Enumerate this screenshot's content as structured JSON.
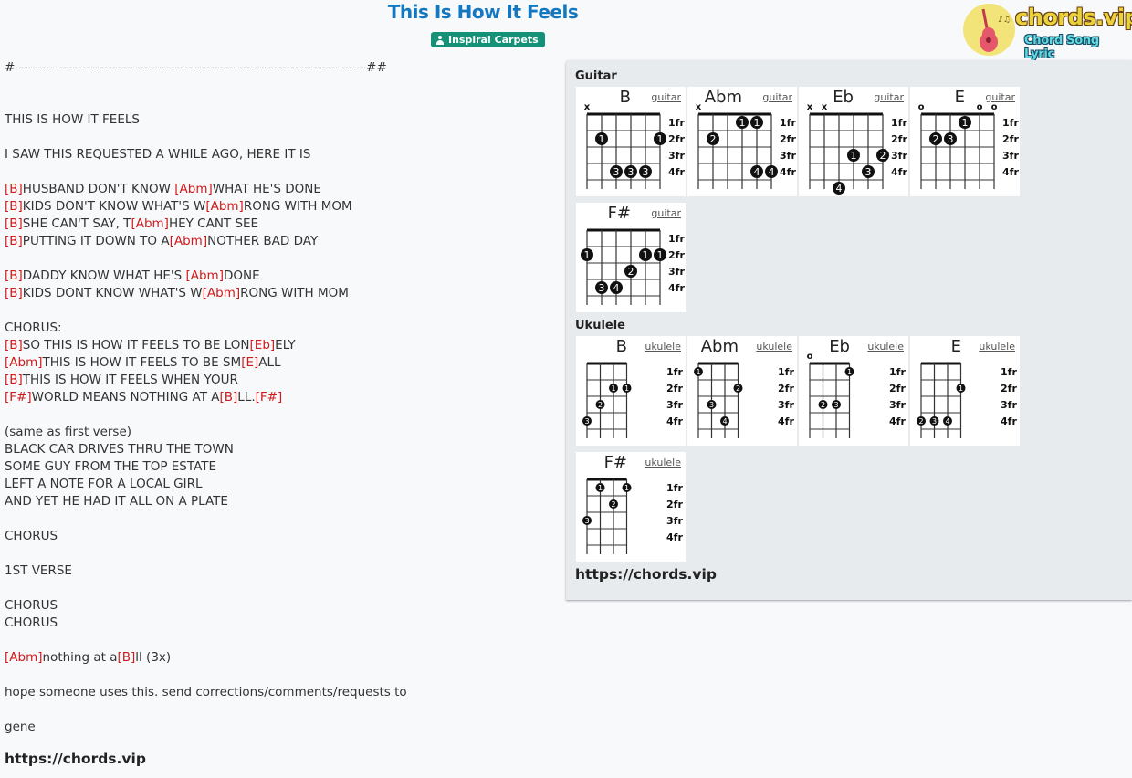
{
  "header": {
    "title": "This Is How It Feels",
    "artist": "Inspiral Carpets",
    "artist_icon": "user-icon",
    "logo_text": "chords.vip",
    "logo_subtitle": "Chord Song Lyric"
  },
  "colors": {
    "title": "#1478c0",
    "badge": "#159177",
    "chord": "#d11a1a",
    "panel": "#e8ebee"
  },
  "lyrics": [
    [
      {
        "t": "#-------------------------------------------------------------------------------##"
      }
    ],
    [],
    [],
    [
      {
        "t": "THIS IS HOW IT FEELS"
      }
    ],
    [],
    [
      {
        "t": "I SAW THIS REQUESTED A WHILE AGO, HERE IT IS"
      }
    ],
    [],
    [
      {
        "c": "[B]"
      },
      {
        "t": "HUSBAND DON'T KNOW "
      },
      {
        "c": "[Abm]"
      },
      {
        "t": "WHAT HE'S DONE"
      }
    ],
    [
      {
        "c": "[B]"
      },
      {
        "t": "KIDS DON'T KNOW WHAT'S W"
      },
      {
        "c": "[Abm]"
      },
      {
        "t": "RONG WITH MOM"
      }
    ],
    [
      {
        "c": "[B]"
      },
      {
        "t": "SHE CAN'T SAY, T"
      },
      {
        "c": "[Abm]"
      },
      {
        "t": "HEY CANT SEE"
      }
    ],
    [
      {
        "c": "[B]"
      },
      {
        "t": "PUTTING IT DOWN TO A"
      },
      {
        "c": "[Abm]"
      },
      {
        "t": "NOTHER BAD DAY"
      }
    ],
    [],
    [
      {
        "c": "[B]"
      },
      {
        "t": "DADDY KNOW WHAT HE'S "
      },
      {
        "c": "[Abm]"
      },
      {
        "t": "DONE"
      }
    ],
    [
      {
        "c": "[B]"
      },
      {
        "t": "KIDS DONT KNOW WHAT'S W"
      },
      {
        "c": "[Abm]"
      },
      {
        "t": "RONG WITH MOM"
      }
    ],
    [],
    [
      {
        "t": "CHORUS:"
      }
    ],
    [
      {
        "c": "[B]"
      },
      {
        "t": "SO THIS IS HOW IT FEELS TO BE LON"
      },
      {
        "c": "[Eb]"
      },
      {
        "t": "ELY"
      }
    ],
    [
      {
        "c": "[Abm]"
      },
      {
        "t": "THIS IS HOW IT FEELS TO BE SM"
      },
      {
        "c": "[E]"
      },
      {
        "t": "ALL"
      }
    ],
    [
      {
        "c": "[B]"
      },
      {
        "t": "THIS IS HOW IT FEELS WHEN YOUR"
      }
    ],
    [
      {
        "c": "[F#]"
      },
      {
        "t": "WORLD MEANS NOTHING AT A"
      },
      {
        "c": "[B]"
      },
      {
        "t": "LL."
      },
      {
        "c": "[F#]"
      }
    ],
    [],
    [
      {
        "t": "(same as first verse)"
      }
    ],
    [
      {
        "t": "BLACK CAR DRIVES THRU THE TOWN"
      }
    ],
    [
      {
        "t": "SOME GUY FROM THE TOP ESTATE"
      }
    ],
    [
      {
        "t": "LEFT A NOTE FOR A LOCAL GIRL"
      }
    ],
    [
      {
        "t": "AND YET HE HAD IT ALL ON A PLATE"
      }
    ],
    [],
    [
      {
        "t": "CHORUS"
      }
    ],
    [],
    [
      {
        "t": "1ST VERSE"
      }
    ],
    [],
    [
      {
        "t": "CHORUS"
      }
    ],
    [
      {
        "t": "CHORUS"
      }
    ],
    [],
    [
      {
        "c": "[Abm]"
      },
      {
        "t": "nothing at a"
      },
      {
        "c": "[B]"
      },
      {
        "t": "ll (3x)"
      }
    ],
    [],
    [
      {
        "t": "hope someone uses this. send corrections/comments/requests to"
      }
    ],
    [],
    [
      {
        "t": "gene"
      }
    ]
  ],
  "footer_link": "https://chords.vip",
  "panel": {
    "guitar_title": "Guitar",
    "ukulele_title": "Ukulele",
    "link": "https://chords.vip",
    "fret_labels": [
      "1fr",
      "2fr",
      "3fr",
      "4fr"
    ],
    "guitar_chords": [
      {
        "name": "B",
        "type": "guitar",
        "markers": [
          "x",
          "",
          "",
          "",
          "",
          ""
        ],
        "dots": [
          {
            "s": 1,
            "f": 2,
            "n": "1"
          },
          {
            "s": 5,
            "f": 2,
            "n": "1"
          },
          {
            "s": 2,
            "f": 4,
            "n": "3"
          },
          {
            "s": 3,
            "f": 4,
            "n": "3"
          },
          {
            "s": 4,
            "f": 4,
            "n": "3"
          }
        ]
      },
      {
        "name": "Abm",
        "type": "guitar",
        "markers": [
          "x",
          "",
          "",
          "",
          "",
          ""
        ],
        "dots": [
          {
            "s": 3,
            "f": 1,
            "n": "1"
          },
          {
            "s": 4,
            "f": 1,
            "n": "1"
          },
          {
            "s": 1,
            "f": 2,
            "n": "2"
          },
          {
            "s": 4,
            "f": 4,
            "n": "4"
          },
          {
            "s": 5,
            "f": 4,
            "n": "4"
          }
        ]
      },
      {
        "name": "Eb",
        "type": "guitar",
        "markers": [
          "x",
          "x",
          "",
          "",
          "",
          ""
        ],
        "dots": [
          {
            "s": 3,
            "f": 3,
            "n": "1"
          },
          {
            "s": 5,
            "f": 3,
            "n": "2"
          },
          {
            "s": 4,
            "f": 4,
            "n": "3"
          },
          {
            "s": 2,
            "f": 5,
            "n": "4"
          }
        ]
      },
      {
        "name": "E",
        "type": "guitar",
        "markers": [
          "o",
          "",
          "",
          "",
          "o",
          "o"
        ],
        "dots": [
          {
            "s": 3,
            "f": 1,
            "n": "1"
          },
          {
            "s": 1,
            "f": 2,
            "n": "2"
          },
          {
            "s": 2,
            "f": 2,
            "n": "3"
          }
        ]
      },
      {
        "name": "F#",
        "type": "guitar",
        "markers": [
          "",
          "",
          "",
          "",
          "",
          ""
        ],
        "dots": [
          {
            "s": 0,
            "f": 2,
            "n": "1"
          },
          {
            "s": 4,
            "f": 2,
            "n": "1"
          },
          {
            "s": 5,
            "f": 2,
            "n": "1"
          },
          {
            "s": 3,
            "f": 3,
            "n": "2"
          },
          {
            "s": 1,
            "f": 4,
            "n": "3"
          },
          {
            "s": 2,
            "f": 4,
            "n": "4"
          }
        ]
      }
    ],
    "ukulele_chords": [
      {
        "name": "B",
        "type": "ukulele",
        "markers": [
          "",
          "",
          "",
          ""
        ],
        "dots": [
          {
            "s": 2,
            "f": 2,
            "n": "1"
          },
          {
            "s": 3,
            "f": 2,
            "n": "1"
          },
          {
            "s": 1,
            "f": 3,
            "n": "2"
          },
          {
            "s": 0,
            "f": 4,
            "n": "3"
          }
        ]
      },
      {
        "name": "Abm",
        "type": "ukulele",
        "markers": [
          "",
          "",
          "",
          ""
        ],
        "dots": [
          {
            "s": 0,
            "f": 1,
            "n": "1"
          },
          {
            "s": 3,
            "f": 2,
            "n": "2"
          },
          {
            "s": 1,
            "f": 3,
            "n": "3"
          },
          {
            "s": 2,
            "f": 4,
            "n": "4"
          }
        ]
      },
      {
        "name": "Eb",
        "type": "ukulele",
        "markers": [
          "o",
          "",
          "",
          ""
        ],
        "dots": [
          {
            "s": 3,
            "f": 1,
            "n": "1"
          },
          {
            "s": 1,
            "f": 3,
            "n": "2"
          },
          {
            "s": 2,
            "f": 3,
            "n": "3"
          }
        ]
      },
      {
        "name": "E",
        "type": "ukulele",
        "markers": [
          "",
          "",
          "",
          ""
        ],
        "dots": [
          {
            "s": 3,
            "f": 2,
            "n": "1"
          },
          {
            "s": 0,
            "f": 4,
            "n": "2"
          },
          {
            "s": 1,
            "f": 4,
            "n": "3"
          },
          {
            "s": 2,
            "f": 4,
            "n": "4"
          }
        ]
      },
      {
        "name": "F#",
        "type": "ukulele",
        "markers": [
          "",
          "",
          "",
          ""
        ],
        "dots": [
          {
            "s": 1,
            "f": 1,
            "n": "1"
          },
          {
            "s": 3,
            "f": 1,
            "n": "1"
          },
          {
            "s": 2,
            "f": 2,
            "n": "2"
          },
          {
            "s": 0,
            "f": 3,
            "n": "3"
          }
        ]
      }
    ]
  }
}
